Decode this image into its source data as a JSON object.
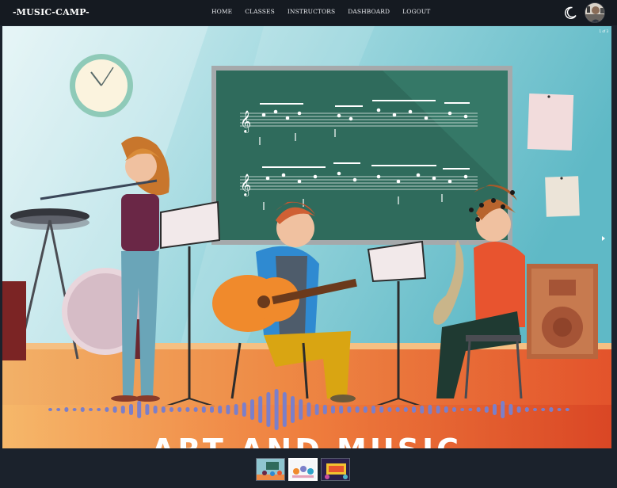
{
  "navbar": {
    "brand": "-MUSIC-CAMP-",
    "links": [
      "HOME",
      "CLASSES",
      "INSTRUCTORS",
      "DASHBOARD",
      "LOGOUT"
    ]
  },
  "hero": {
    "slide_counter": "1 of 3",
    "banner_text": "ART AND MUSIC"
  },
  "thumbnails": {
    "count": 3,
    "active_index": 1
  },
  "colors": {
    "navbar_bg": "#151a21",
    "page_bg": "#1b222c",
    "wall": "#7fc9d3",
    "floor": "#e8743a",
    "chalkboard": "#2f6b5c",
    "soundwave": "#7b7fc9"
  }
}
